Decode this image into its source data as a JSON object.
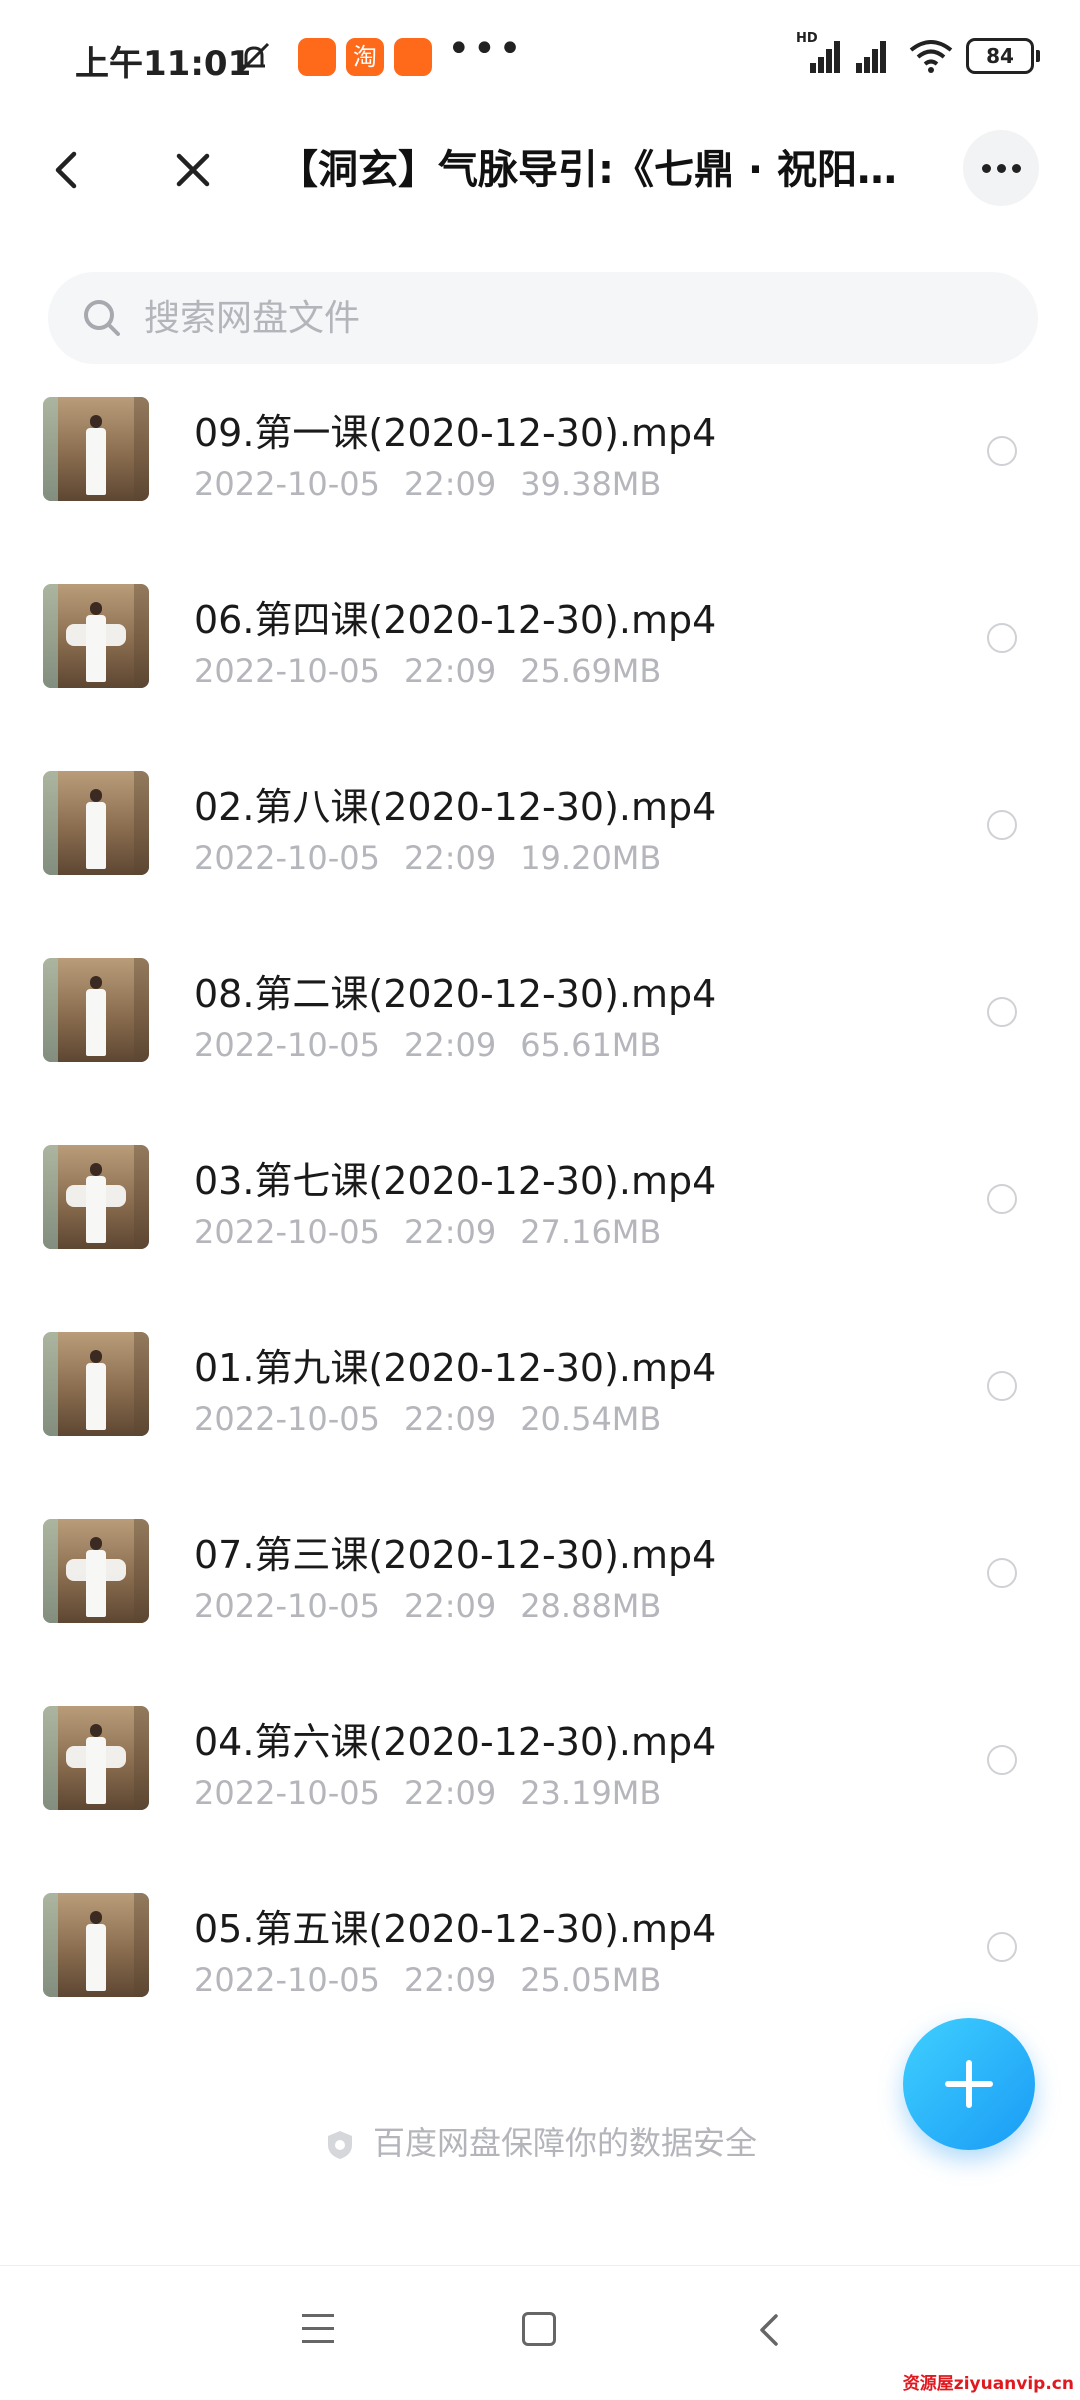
{
  "status_bar": {
    "time": "上午11:01",
    "app1_label": "",
    "app2_label": "淘",
    "app3_label": "",
    "more_dots": "•••",
    "signal_label": "HD",
    "battery": "84"
  },
  "header": {
    "title": "【洞玄】气脉导引:《七鼎 · 祝阳…"
  },
  "search": {
    "placeholder": "搜索网盘文件"
  },
  "files": [
    {
      "name": "09.第一课(2020-12-30).mp4",
      "date": "2022-10-05",
      "time": "22:09",
      "size": "39.38MB"
    },
    {
      "name": "06.第四课(2020-12-30).mp4",
      "date": "2022-10-05",
      "time": "22:09",
      "size": "25.69MB"
    },
    {
      "name": "02.第八课(2020-12-30).mp4",
      "date": "2022-10-05",
      "time": "22:09",
      "size": "19.20MB"
    },
    {
      "name": "08.第二课(2020-12-30).mp4",
      "date": "2022-10-05",
      "time": "22:09",
      "size": "65.61MB"
    },
    {
      "name": "03.第七课(2020-12-30).mp4",
      "date": "2022-10-05",
      "time": "22:09",
      "size": "27.16MB"
    },
    {
      "name": "01.第九课(2020-12-30).mp4",
      "date": "2022-10-05",
      "time": "22:09",
      "size": "20.54MB"
    },
    {
      "name": "07.第三课(2020-12-30).mp4",
      "date": "2022-10-05",
      "time": "22:09",
      "size": "28.88MB"
    },
    {
      "name": "04.第六课(2020-12-30).mp4",
      "date": "2022-10-05",
      "time": "22:09",
      "size": "23.19MB"
    },
    {
      "name": "05.第五课(2020-12-30).mp4",
      "date": "2022-10-05",
      "time": "22:09",
      "size": "25.05MB"
    }
  ],
  "footer_note": "百度网盘保障你的数据安全",
  "watermark": "资源屋ziyuanvip.cn",
  "colors": {
    "accent": "#1a9bf5",
    "meta_text": "#b4b6bb",
    "app_icon": "#ff6a1a"
  },
  "icons": {
    "back": "chevron-left-icon",
    "close": "close-icon",
    "more": "more-horizontal-icon",
    "search": "search-icon",
    "add": "plus-icon",
    "shield": "shield-icon"
  }
}
